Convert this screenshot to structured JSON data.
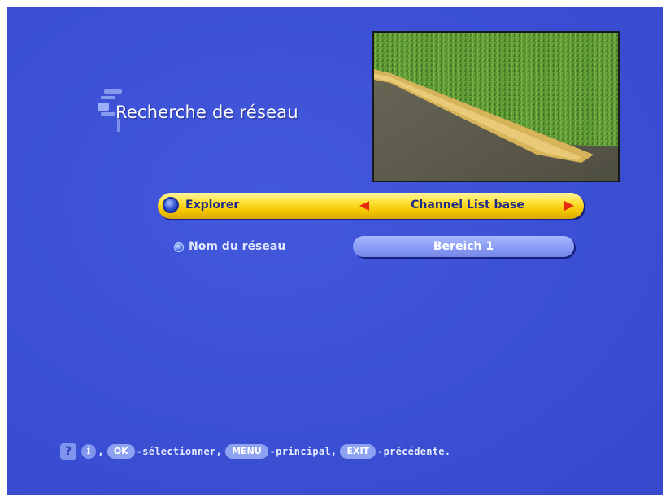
{
  "colors": {
    "background": "#3d52d6",
    "highlight_row": "#ffe13a",
    "arrow": "#e62a12",
    "field": "#8c9ef5",
    "text_dark": "#1e2a86",
    "text_light": "#ffffff"
  },
  "header": {
    "title": "Recherche de réseau",
    "icon": "network-search-icon"
  },
  "preview": {
    "icon": "live-tv-preview"
  },
  "menu": {
    "explorer": {
      "label": "Explorer",
      "value": "Channel List base",
      "left_arrow_icon": "arrow-left-icon",
      "right_arrow_icon": "arrow-right-icon"
    },
    "network_name": {
      "label": "Nom du réseau",
      "value": "Bereich 1"
    }
  },
  "help": {
    "help_key": "?",
    "info_key": "i",
    "comma1": ",",
    "ok_key": "OK",
    "ok_text": "-sélectionner,",
    "menu_key": "MENU",
    "menu_text": "-principal,",
    "exit_key": "EXIT",
    "exit_text": "-précédente."
  }
}
